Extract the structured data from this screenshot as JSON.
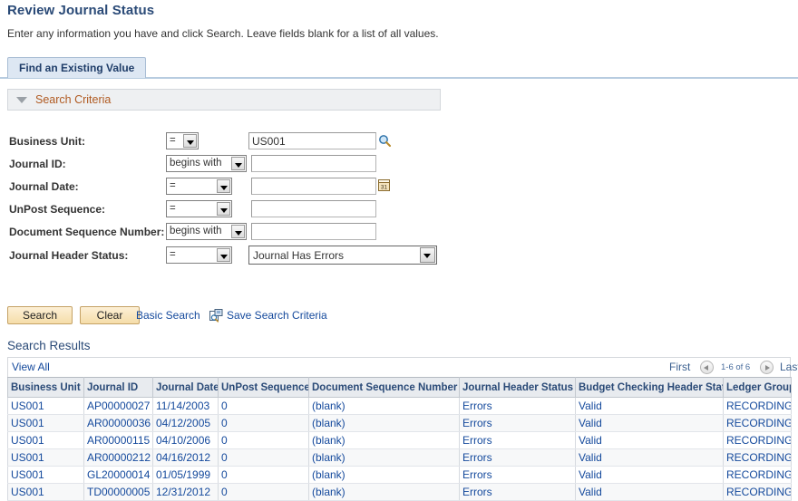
{
  "page": {
    "title": "Review Journal Status",
    "instructions": "Enter any information you have and click Search. Leave fields blank for a list of all values."
  },
  "tabs": [
    {
      "label": "Find an Existing Value",
      "active": true
    }
  ],
  "search_criteria_section": {
    "label": "Search Criteria",
    "collapse_icon": "triangle-down-icon"
  },
  "criteria": [
    {
      "label": "Business Unit:",
      "operator": "=",
      "value": "US001",
      "placeholder": "",
      "has_lookup": true,
      "has_calendar": false
    },
    {
      "label": "Journal ID:",
      "operator": "begins with",
      "value": "",
      "placeholder": "",
      "has_lookup": false,
      "has_calendar": false
    },
    {
      "label": "Journal Date:",
      "operator": "=",
      "value": "",
      "placeholder": "",
      "has_lookup": false,
      "has_calendar": true
    },
    {
      "label": "UnPost Sequence:",
      "operator": "=",
      "value": "",
      "placeholder": "",
      "has_lookup": false,
      "has_calendar": false
    },
    {
      "label": "Document Sequence Number:",
      "operator": "begins with",
      "value": "",
      "placeholder": "",
      "has_lookup": false,
      "has_calendar": false
    },
    {
      "label": "Journal Header Status:",
      "operator": "=",
      "value": "Journal Has Errors",
      "is_dropdown": true
    }
  ],
  "actions": {
    "search_label": "Search",
    "clear_label": "Clear",
    "basic_search_label": "Basic Search",
    "save_search_criteria_label": "Save Search Criteria",
    "save_icon": "save-search-icon"
  },
  "results": {
    "title": "Search Results",
    "view_all_label": "View All",
    "first_label": "First",
    "last_label": "Last",
    "count_label": "1-6 of 6",
    "prev_icon": "chevron-left-icon",
    "next_icon": "chevron-right-icon",
    "columns": [
      "Business Unit",
      "Journal ID",
      "Journal Date",
      "UnPost Sequence",
      "Document Sequence Number",
      "Journal Header Status",
      "Budget Checking Header Status",
      "Ledger Group"
    ],
    "rows": [
      [
        "US001",
        "AP00000027",
        "11/14/2003",
        "0",
        "(blank)",
        "Errors",
        "Valid",
        "RECORDING"
      ],
      [
        "US001",
        "AR00000036",
        "04/12/2005",
        "0",
        "(blank)",
        "Errors",
        "Valid",
        "RECORDING"
      ],
      [
        "US001",
        "AR00000115",
        "04/10/2006",
        "0",
        "(blank)",
        "Errors",
        "Valid",
        "RECORDING"
      ],
      [
        "US001",
        "AR00000212",
        "04/16/2012",
        "0",
        "(blank)",
        "Errors",
        "Valid",
        "RECORDING"
      ],
      [
        "US001",
        "GL20000014",
        "01/05/1999",
        "0",
        "(blank)",
        "Errors",
        "Valid",
        "RECORDING"
      ],
      [
        "US001",
        "TD00000005",
        "12/31/2012",
        "0",
        "(blank)",
        "Errors",
        "Valid",
        "RECORDING"
      ]
    ]
  },
  "colors": {
    "heading": "#2a4a77",
    "link": "#14499c",
    "section_label": "#b05a21",
    "button_face": "#f5dda9",
    "tab_active": "#dde7f3"
  }
}
